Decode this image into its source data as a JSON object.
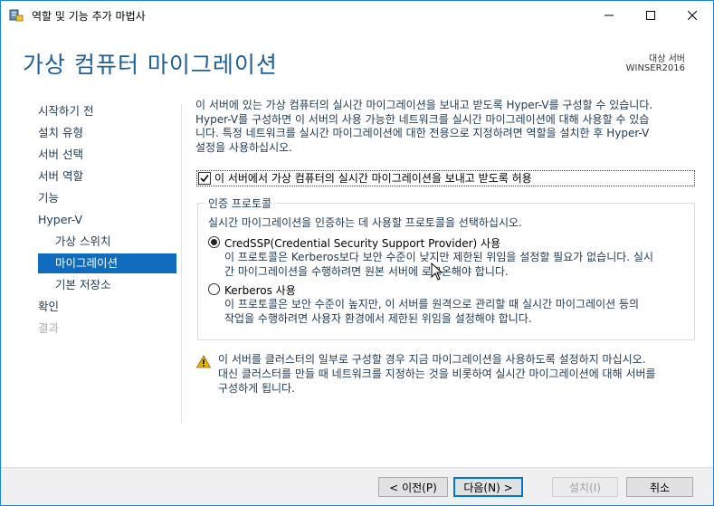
{
  "window": {
    "title": "역할 및 기능 추가 마법사"
  },
  "header": {
    "page_title": "가상 컴퓨터 마이그레이션",
    "destination_label": "대상 서버",
    "destination_value": "WINSER2016"
  },
  "nav": {
    "items": [
      {
        "label": "시작하기 전",
        "state": "normal"
      },
      {
        "label": "설치 유형",
        "state": "normal"
      },
      {
        "label": "서버 선택",
        "state": "normal"
      },
      {
        "label": "서버 역할",
        "state": "normal"
      },
      {
        "label": "기능",
        "state": "normal"
      },
      {
        "label": "Hyper-V",
        "state": "normal"
      },
      {
        "label": "가상 스위치",
        "state": "sub"
      },
      {
        "label": "마이그레이션",
        "state": "selected"
      },
      {
        "label": "기본 저장소",
        "state": "sub"
      },
      {
        "label": "확인",
        "state": "normal"
      },
      {
        "label": "결과",
        "state": "disabled"
      }
    ]
  },
  "main": {
    "intro_lines": [
      "이 서버에 있는 가상 컴퓨터의 실시간 마이그레이션을 보내고 받도록 Hyper-V를 구성할 수 있습니다.",
      "Hyper-V를 구성하면 이 서버의 사용 가능한 네트워크를 실시간 마이그레이션에 대해 사용할 수 있습",
      "니다. 특정 네트워크를 실시간 마이그레이션에 대한 전용으로 지정하려면 역할을 설치한 후 Hyper-V",
      "설정을 사용하십시오."
    ],
    "allow_checkbox_label": "이 서버에서 가상 컴퓨터의 실시간 마이그레이션을 보내고 받도록 허용",
    "allow_checked": true,
    "auth_group": {
      "title": "인증 프로토콜",
      "description": "실시간 마이그레이션을 인증하는 데 사용할 프로토콜을 선택하십시오.",
      "options": [
        {
          "label": "CredSSP(Credential Security Support Provider) 사용",
          "selected": true,
          "desc_lines": [
            "이 프로토콜은 Kerberos보다 보안 수준이 낮지만 제한된 위임을 설정할 필요가 없습니다. 실시",
            "간 마이그레이션을 수행하려면 원본 서버에 로그온해야 합니다."
          ]
        },
        {
          "label": "Kerberos 사용",
          "selected": false,
          "desc_lines": [
            "이 프로토콜은 보안 수준이 높지만, 이 서버를 원격으로 관리할 때 실시간 마이그레이션 등의",
            "작업을 수행하려면 사용자 환경에서 제한된 위임을 설정해야 합니다."
          ]
        }
      ]
    },
    "warning_lines": [
      "이 서버를 클러스터의 일부로 구성할 경우 지금 마이그레이션을 사용하도록 설정하지 마십시오.",
      "대신 클러스터를 만들 때 네트워크를 지정하는 것을 비롯하여 실시간 마이그레이션에 대해 서버를",
      "구성하게 됩니다."
    ]
  },
  "footer": {
    "prev_label": "< 이전(P)",
    "next_label": "다음(N) >",
    "install_label": "설치(I)",
    "cancel_label": "취소"
  },
  "colors": {
    "accent": "#0f6cbd",
    "title_blue": "#1f5f99",
    "warning": "#e8b400"
  },
  "icons": {
    "app": "server-manager-icon",
    "warning": "warning-icon"
  }
}
